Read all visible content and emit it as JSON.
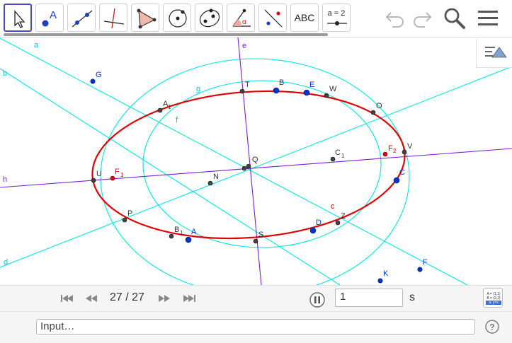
{
  "toolbar": {
    "tools": [
      {
        "name": "move-tool",
        "icon": "arrow-cursor-icon",
        "selected": true
      },
      {
        "name": "point-tool",
        "icon": "point-a-icon",
        "label": "A"
      },
      {
        "name": "line-tool",
        "icon": "line-through-points-icon"
      },
      {
        "name": "perpendicular-line-tool",
        "icon": "perpendicular-line-icon"
      },
      {
        "name": "polygon-tool",
        "icon": "polygon-icon"
      },
      {
        "name": "circle-tool",
        "icon": "circle-center-point-icon"
      },
      {
        "name": "ellipse-tool",
        "icon": "ellipse-icon"
      },
      {
        "name": "angle-tool",
        "icon": "angle-icon",
        "label": "α"
      },
      {
        "name": "reflect-tool",
        "icon": "reflect-about-line-icon"
      },
      {
        "name": "text-tool",
        "icon": "text-icon",
        "label": "ABC"
      },
      {
        "name": "slider-tool",
        "icon": "slider-icon",
        "label": "a = 2"
      }
    ],
    "undo_icon": "undo-icon",
    "redo_icon": "redo-icon",
    "search_icon": "search-icon",
    "menu_icon": "hamburger-menu-icon"
  },
  "graphics": {
    "style_bar_icon": "style-bar-toggle-icon",
    "line_labels": {
      "a": "a",
      "b": "b",
      "d": "d",
      "e": "e",
      "h": "h",
      "f": "f",
      "g": "g",
      "c": "c"
    },
    "points": {
      "G": "G",
      "T": "T",
      "B": "B",
      "E": "E",
      "W": "W",
      "A1": "A",
      "A1_sub": "1",
      "O": "O",
      "F2": "F",
      "F2_sub": "2",
      "V": "V",
      "C1": "C",
      "C1_sub": "1",
      "C": "C",
      "Q": "Q",
      "U": "U",
      "F1": "F",
      "F1_sub": "1",
      "N": "N",
      "P": "P",
      "Z": "Z",
      "D": "D",
      "B1": "B",
      "B1_sub": "1",
      "A": "A",
      "S": "S",
      "F": "F",
      "K": "K"
    },
    "colors": {
      "ellipse": "#e00000",
      "aux_lines": "#00e5e5",
      "axis_line": "#7a1fd6",
      "free_point": "#0033cc",
      "dependent_point": "#333333",
      "focus_label": "#e00000"
    }
  },
  "animation": {
    "frame": "27 / 27",
    "speed_value": "1",
    "speed_unit": "s",
    "first_icon": "skip-to-start-icon",
    "prev_icon": "step-back-icon",
    "next_icon": "step-forward-icon",
    "last_icon": "skip-to-end-icon",
    "pause_icon": "pause-icon",
    "algebra_desc_lines": [
      "A = (1,1)",
      "B = (2,2)",
      "a: y=x"
    ]
  },
  "input_bar": {
    "placeholder": "Input…",
    "help_icon": "help-icon"
  }
}
